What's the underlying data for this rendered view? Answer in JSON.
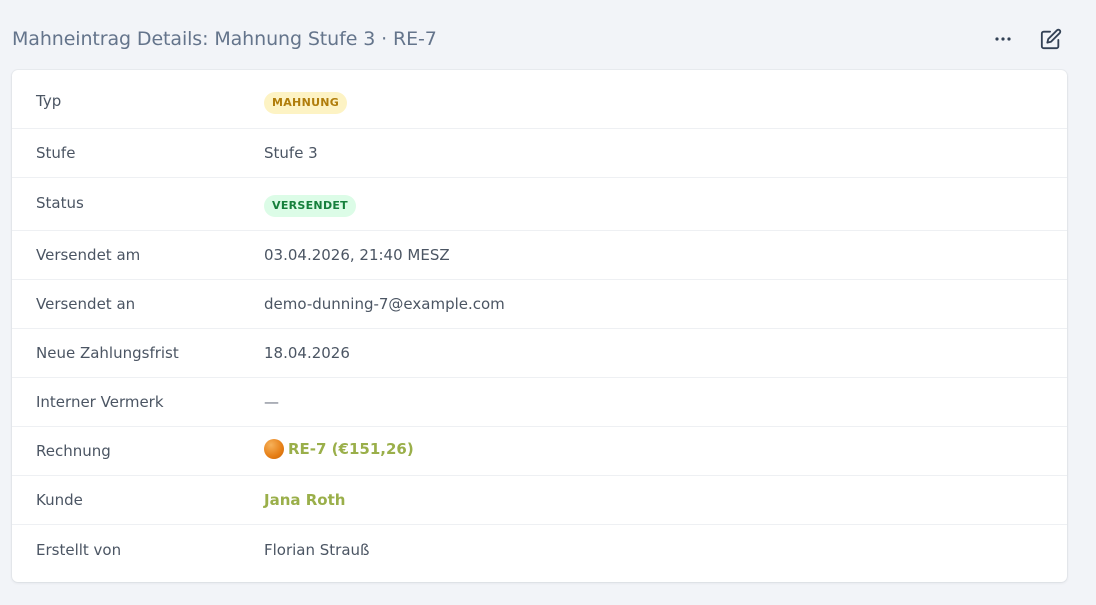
{
  "header": {
    "title": "Mahneintrag Details: Mahnung Stufe 3 · RE-7",
    "more_icon": "ellipsis-icon",
    "edit_icon": "edit-icon"
  },
  "details": {
    "typ": {
      "label": "Typ",
      "value": "MAHNUNG"
    },
    "stufe": {
      "label": "Stufe",
      "value": "Stufe 3"
    },
    "status": {
      "label": "Status",
      "value": "VERSENDET"
    },
    "versendet_am": {
      "label": "Versendet am",
      "value": "03.04.2026, 21:40 MESZ"
    },
    "versendet_an": {
      "label": "Versendet an",
      "value": "demo-dunning-7@example.com"
    },
    "zahlungsfrist": {
      "label": "Neue Zahlungsfrist",
      "value": "18.04.2026"
    },
    "vermerk": {
      "label": "Interner Vermerk",
      "value": "—"
    },
    "rechnung": {
      "label": "Rechnung",
      "value": "RE-7 (€151,26)",
      "icon": "orange-status-dot-icon"
    },
    "kunde": {
      "label": "Kunde",
      "value": "Jana Roth"
    },
    "erstellt_von": {
      "label": "Erstellt von",
      "value": "Florian Strauß"
    }
  },
  "colors": {
    "link": "#9aaf4a",
    "badge_warn_bg": "#fdf3c4",
    "badge_warn_text": "#b07d0b",
    "badge_ok_bg": "#dcfce7",
    "badge_ok_text": "#16803c",
    "page_bg": "#f2f4f8"
  }
}
